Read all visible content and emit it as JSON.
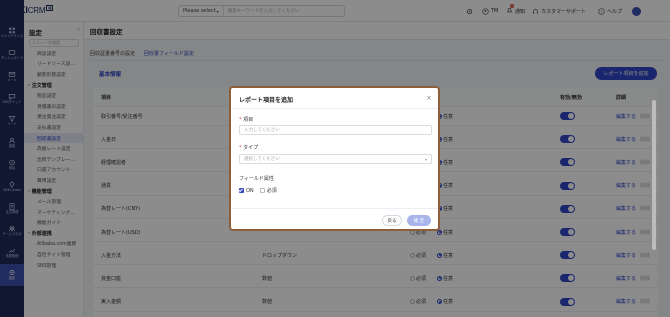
{
  "brand": {
    "name": "OKKI",
    "suffix": "CRM",
    "badge": "開"
  },
  "search": {
    "select_label": "Please select",
    "placeholder": "検索キーワードを入力してください"
  },
  "topbar": {
    "user": "TM",
    "notify": "通知",
    "notify_count": "9",
    "support": "カスタマーサポート",
    "help": "ヘルプ"
  },
  "rail": [
    {
      "label": "メインテナンス",
      "icon": "grid-icon"
    },
    {
      "label": "ダッシュボード",
      "icon": "dashboard-icon"
    },
    {
      "label": "メール",
      "icon": "mail-icon"
    },
    {
      "label": "SNSチャット",
      "icon": "chat-icon"
    },
    {
      "label": "リード",
      "icon": "lead-icon"
    },
    {
      "label": "顧客",
      "icon": "customer-icon"
    },
    {
      "label": "商談",
      "icon": "deal-icon"
    },
    {
      "label": "OKKI Leads",
      "icon": "leads-icon"
    },
    {
      "label": "注文管理",
      "icon": "order-icon"
    },
    {
      "label": "チームコラボ",
      "icon": "team-icon"
    },
    {
      "label": "事業管理",
      "icon": "business-icon"
    },
    {
      "label": "設定",
      "icon": "settings-icon"
    }
  ],
  "sidebar": {
    "title": "設定",
    "search_placeholder": "メニューを検索",
    "items": [
      {
        "type": "item",
        "label": "商談設定"
      },
      {
        "type": "item",
        "label": "リードソース設..."
      },
      {
        "type": "item",
        "label": "顧客形態設定"
      },
      {
        "type": "group",
        "label": "注文管理"
      },
      {
        "type": "item",
        "label": "製品設定"
      },
      {
        "type": "item",
        "label": "見積書の設定"
      },
      {
        "type": "item",
        "label": "受注発注設定"
      },
      {
        "type": "item",
        "label": "支払書設定"
      },
      {
        "type": "item",
        "label": "回収書設定",
        "active": true
      },
      {
        "type": "item",
        "label": "為替レート設定"
      },
      {
        "type": "item",
        "label": "出荷テンプレー..."
      },
      {
        "type": "item",
        "label": "口座アカウント"
      },
      {
        "type": "item",
        "label": "費用設定"
      },
      {
        "type": "group",
        "label": "機能管理"
      },
      {
        "type": "item",
        "label": "メール管理"
      },
      {
        "type": "item",
        "label": "マーケティング..."
      },
      {
        "type": "item",
        "label": "機能ガイド"
      },
      {
        "type": "group",
        "label": "外部連携"
      },
      {
        "type": "item",
        "label": "Alibaba.com連携"
      },
      {
        "type": "item",
        "label": "自社サイト管理"
      },
      {
        "type": "item",
        "label": "SNS管理"
      }
    ]
  },
  "main": {
    "title": "回収書設定",
    "tabs": [
      {
        "label": "回収証書番号の設定",
        "active": false
      },
      {
        "label": "回収書フィールド設定",
        "active": true
      }
    ],
    "section_title": "基本情報",
    "add_button": "レポート項目を追加",
    "columns": {
      "name": "項目",
      "enabled": "有効/無効",
      "detail": "詳細"
    },
    "edit_label": "編集する",
    "delete_label": "削除",
    "required_label": "必須",
    "optional_label": "任意",
    "rows": [
      {
        "name": "取引番号/受注番号",
        "type": "",
        "required": false
      },
      {
        "name": "入金日",
        "type": "",
        "required": false
      },
      {
        "name": "経理確認者",
        "type": "",
        "required": false
      },
      {
        "name": "通貨",
        "type": "",
        "required": false
      },
      {
        "name": "為替レート(CNY)",
        "type": "",
        "required": false
      },
      {
        "name": "為替レート(USD)",
        "type": "",
        "required": false
      },
      {
        "name": "入金方法",
        "type": "ドロップダウン",
        "required": false
      },
      {
        "name": "資金口座",
        "type": "数値",
        "required": false
      },
      {
        "name": "実入金額",
        "type": "数値",
        "required": false
      }
    ]
  },
  "modal": {
    "title": "レポート項目を追加",
    "item_label": "項目",
    "item_placeholder": "入力してください",
    "type_label": "タイプ",
    "type_placeholder": "選択してください",
    "attr_label": "フィールド属性",
    "on_label": "ON",
    "required_label": "必須",
    "cancel": "戻る",
    "ok": "確 定"
  }
}
